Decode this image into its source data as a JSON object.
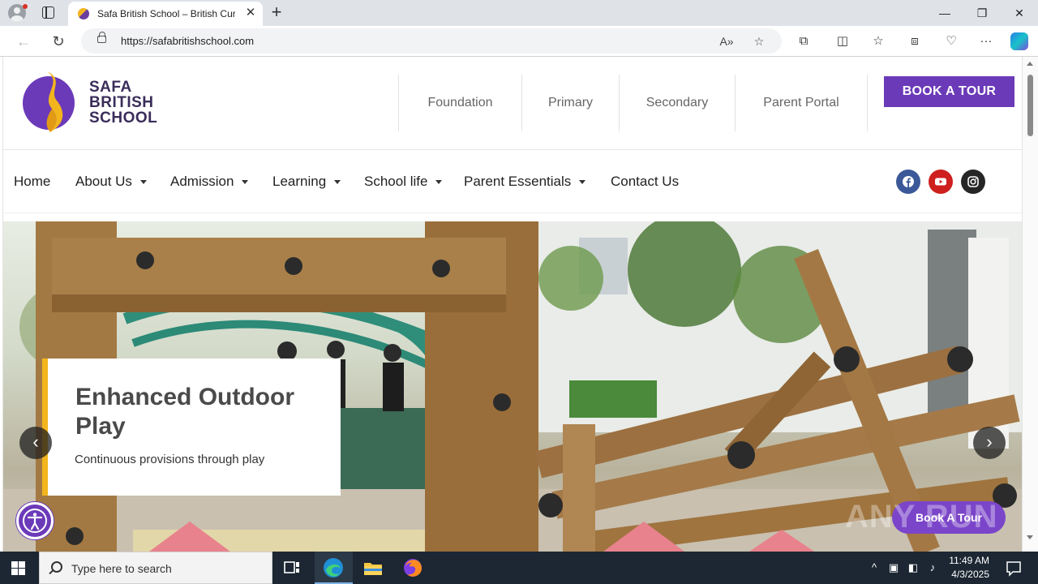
{
  "browser": {
    "tab_title": "Safa British School – British Curri",
    "tab_close": "✕",
    "new_tab": "+",
    "url": "https://safabritishschool.com",
    "window_min": "—",
    "window_max": "❐",
    "window_close": "✕"
  },
  "site": {
    "logo_lines": [
      "SAFA",
      "BRITISH",
      "SCHOOL"
    ],
    "top_links": [
      "Foundation",
      "Primary",
      "Secondary",
      "Parent Portal"
    ],
    "book_tour": "BOOK A TOUR",
    "main_nav": [
      {
        "label": "Home",
        "dropdown": false
      },
      {
        "label": "About Us",
        "dropdown": true
      },
      {
        "label": "Admission",
        "dropdown": true
      },
      {
        "label": "Learning",
        "dropdown": true
      },
      {
        "label": "School life",
        "dropdown": true
      },
      {
        "label": "Parent Essentials",
        "dropdown": true
      },
      {
        "label": "Contact Us",
        "dropdown": false
      }
    ],
    "social": [
      {
        "name": "facebook-icon",
        "color": "#3b5998"
      },
      {
        "name": "youtube-icon",
        "color": "#cd201f"
      },
      {
        "name": "instagram-icon",
        "color": "#262626"
      }
    ]
  },
  "hero": {
    "title": "Enhanced Outdoor Play",
    "subtitle": "Continuous provisions through play",
    "prev_arrow": "‹",
    "next_arrow": "›",
    "book_tour": "Book A Tour",
    "watermark": "ANY RUN"
  },
  "colors": {
    "brand_purple": "#6b3ab8",
    "brand_yellow": "#f2b51d"
  },
  "taskbar": {
    "search_placeholder": "Type here to search",
    "time": "11:49 AM",
    "date": "4/3/2025"
  }
}
